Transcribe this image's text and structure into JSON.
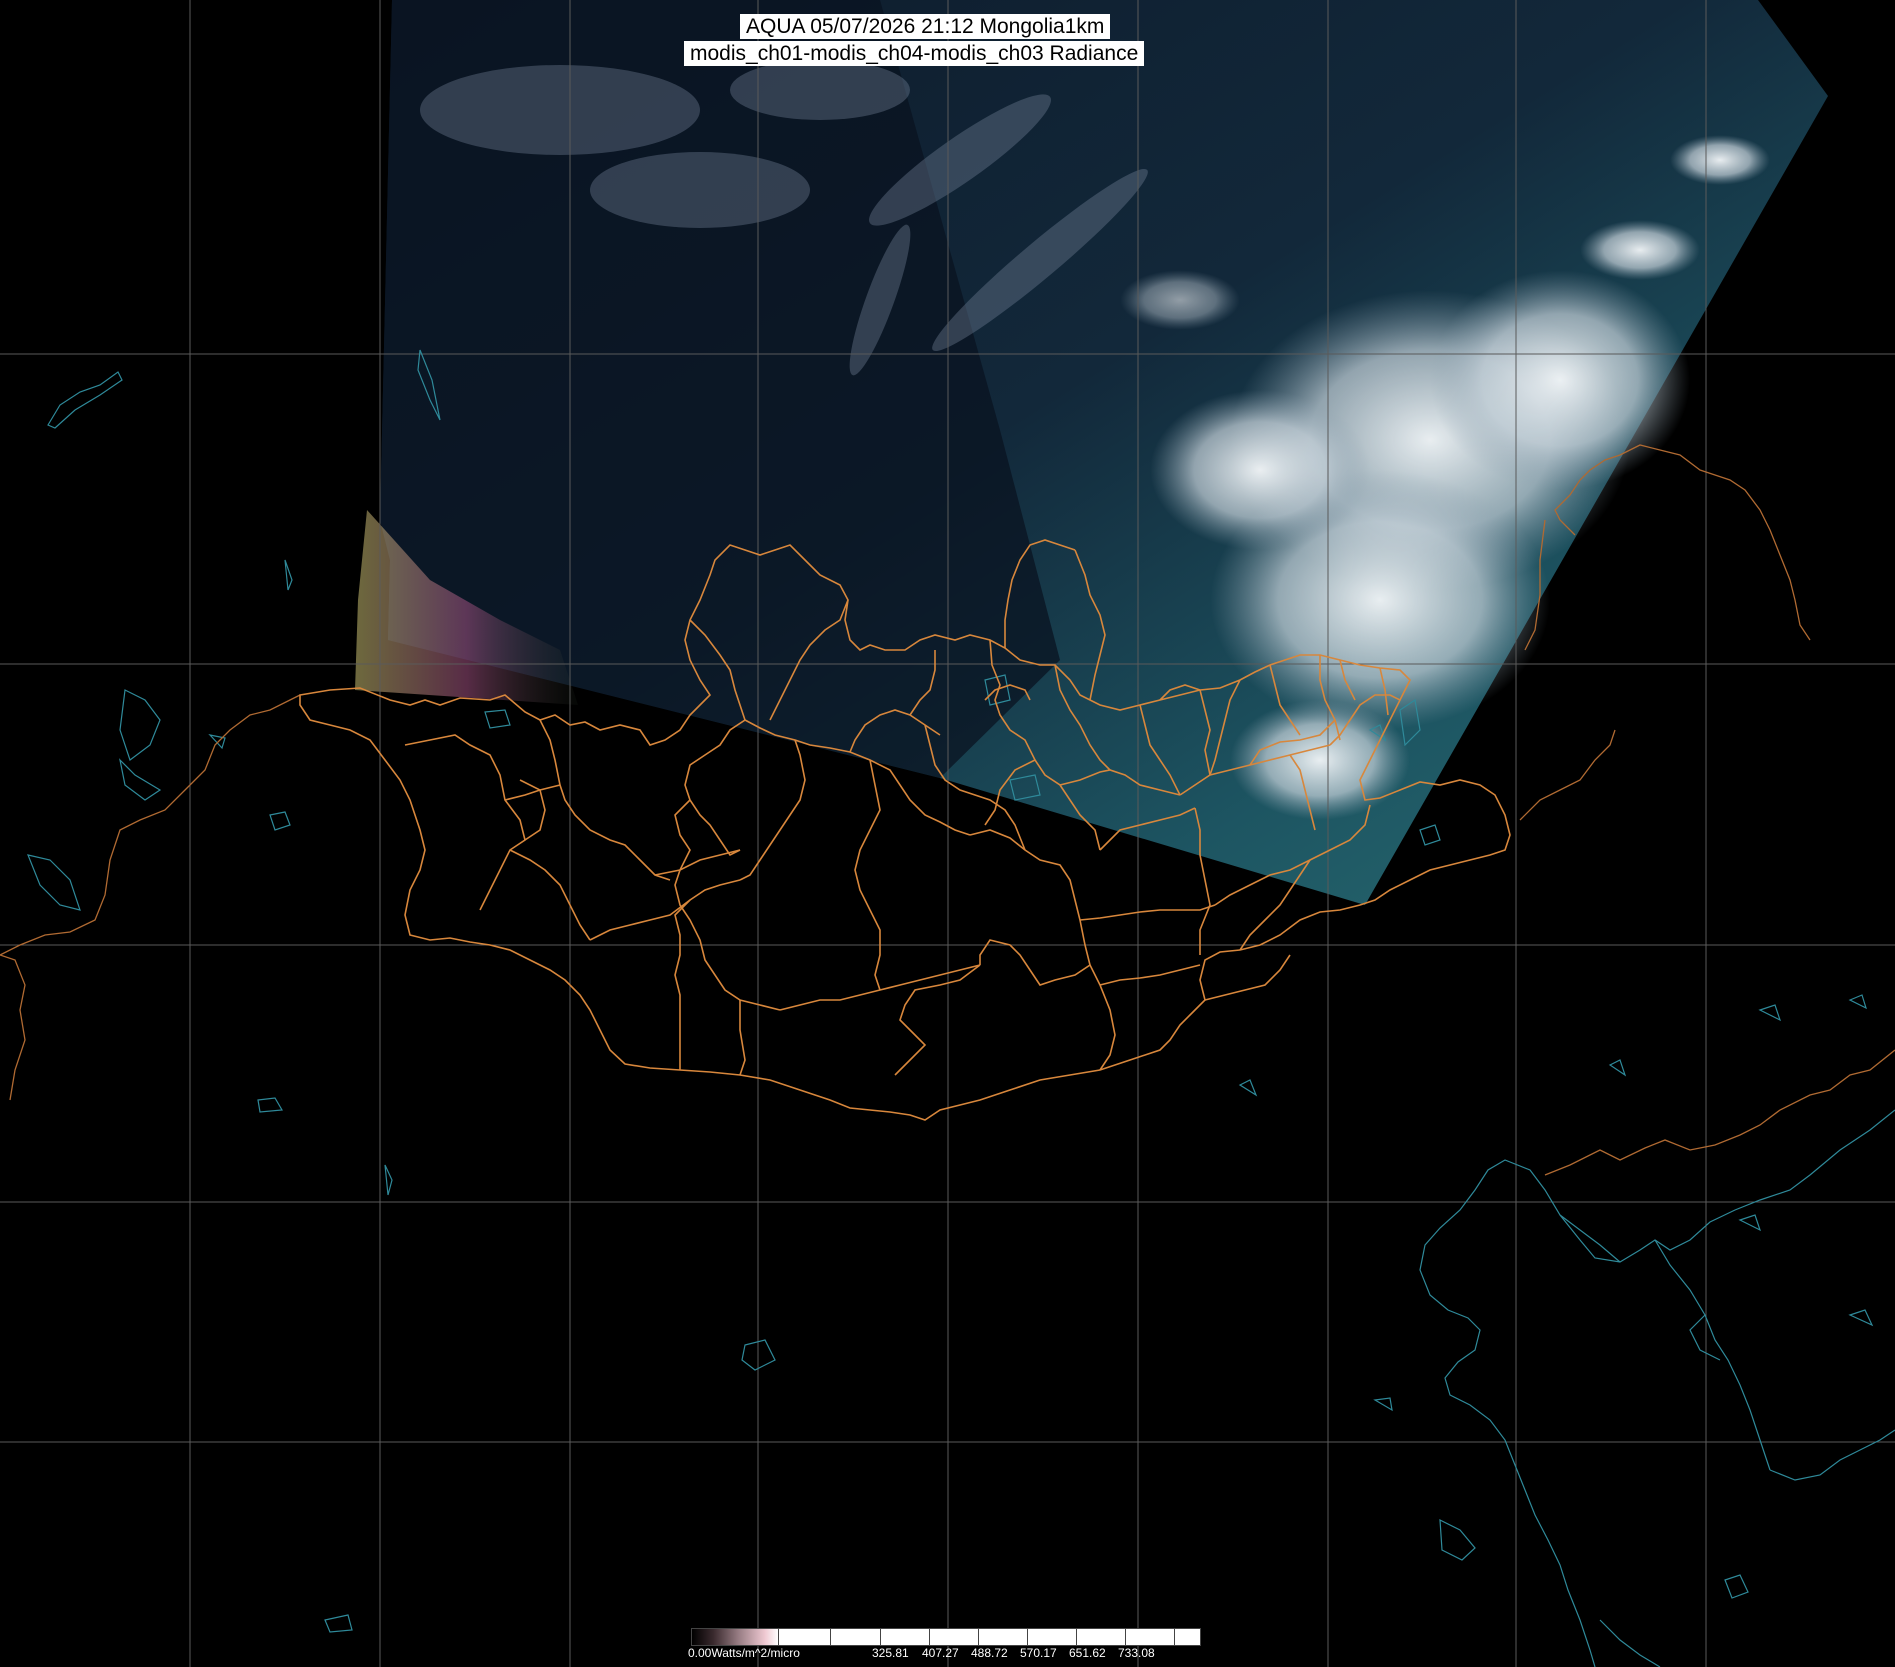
{
  "title": {
    "line1": "AQUA 05/07/2026 21:12 Mongolia1km",
    "line2": "modis_ch01-modis_ch04-modis_ch03 Radiance"
  },
  "legend": {
    "unit_label": "0.00Watts/m^2/micro",
    "values": [
      "325.81",
      "407.27",
      "488.72",
      "570.17",
      "651.62",
      "733.08"
    ]
  },
  "colors": {
    "background": "#000000",
    "graticule": "#5a5a5a",
    "province_border": "#d8873c",
    "country_border": "#b06a32",
    "coast_water": "#2f8a9a",
    "cloud": "#e8eef2",
    "land_swath": "#1e4a5e"
  }
}
